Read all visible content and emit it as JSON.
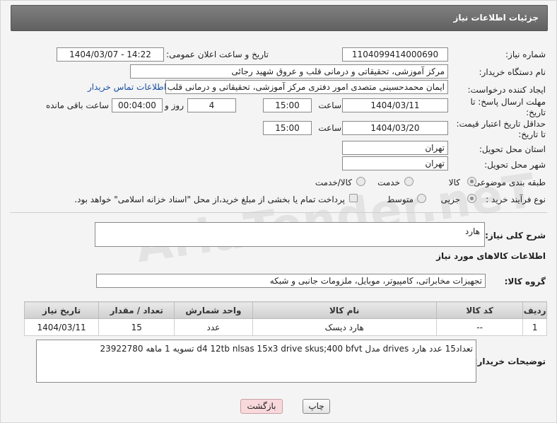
{
  "title": "جزئیات اطلاعات نیاز",
  "fields": {
    "need_number_label": "شماره نیاز:",
    "need_number": "1104099414000690",
    "announce_label": "تاریخ و ساعت اعلان عمومی:",
    "announce_value": "1404/03/07 - 14:22",
    "buyer_org_label": "نام دستگاه خریدار:",
    "buyer_org": "مرکز آموزشی، تحقیقاتی و درمانی قلب و عروق شهید رجائی",
    "creator_label": "ایجاد کننده درخواست:",
    "creator": "ایمان محمدحسینی متصدی امور دفتری مرکز آموزشی، تحقیقاتی و درمانی قلب",
    "contact_link": "اطلاعات تماس خریدار",
    "deadline_label": "مهلت ارسال پاسخ: تا تاریخ:",
    "deadline_date": "1404/03/11",
    "time_label": "ساعت",
    "deadline_time": "15:00",
    "days_value": "4",
    "days_label": "روز و",
    "remaining_time": "00:04:00",
    "remaining_label": "ساعت باقی مانده",
    "min_price_label": "حداقل تاریخ اعتبار قیمت: تا تاریخ:",
    "min_price_date": "1404/03/20",
    "min_price_time": "15:00",
    "province_label": "استان محل تحویل:",
    "province": "تهران",
    "city_label": "شهر محل تحویل:",
    "city": "تهران",
    "category_label": "طبقه بندی موضوعی:",
    "category_options": [
      "کالا",
      "خدمت",
      "کالا/خدمت"
    ],
    "process_label": "نوع فرآیند خرید :",
    "process_options": [
      "جزیی",
      "متوسط"
    ],
    "payment_note": "پرداخت تمام یا بخشی از مبلغ خرید،از محل \"اسناد خزانه اسلامی\" خواهد بود."
  },
  "summary": {
    "label": "شرح کلی نیاز:",
    "value": "هارد"
  },
  "goods": {
    "section_title": "اطلاعات کالاهای مورد نیاز",
    "group_label": "گروه کالا:",
    "group_value": "تجهیزات مخابراتی، کامپیوتر، موبایل، ملزومات جانبی و شبکه",
    "columns": [
      "ردیف",
      "کد کالا",
      "نام کالا",
      "واحد شمارش",
      "تعداد / مقدار",
      "تاریخ نیاز"
    ],
    "rows": [
      [
        "1",
        "--",
        "هارد دیسک",
        "عدد",
        "15",
        "1404/03/11"
      ]
    ]
  },
  "buyer_notes": {
    "label": "توضیحات خریدار:",
    "value": "تعداد15 عدد هارد drives مدل d4 12tb nlsas 15x3 drive skus;400 bfvt تسویه 1 ماهه 23922780"
  },
  "buttons": {
    "print": "چاپ",
    "back": "بازگشت"
  },
  "watermark": "AriaTender.neT"
}
